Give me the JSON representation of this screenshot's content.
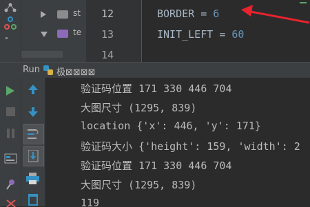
{
  "project_tree": {
    "rows": [
      {
        "label": "st"
      },
      {
        "label": "te"
      }
    ]
  },
  "editor": {
    "lines": [
      {
        "number": "12",
        "name": "BORDER",
        "op": "=",
        "value": "6"
      },
      {
        "number": "13",
        "name": "INIT_LEFT",
        "op": "=",
        "value": "60"
      },
      {
        "number": "14",
        "name": "",
        "op": "",
        "value": ""
      }
    ]
  },
  "run_panel": {
    "tab_label": "Run",
    "config_name": "极⊠⊠⊠⊠",
    "console_lines": [
      "验证码位置 171 330 446 704",
      "大图尺寸 (1295, 839)",
      "location {'x': 446, 'y': 171}",
      "验证码大小 {'height': 159, 'width': 2",
      "验证码位置 171 330 446 704",
      "大图尺寸 (1295, 839)",
      "119"
    ]
  },
  "colors": {
    "annotation_arrow": "#e8232d",
    "accent_green": "#59a869",
    "accent_blue": "#3592c4",
    "folder_purple": "#8d6ab8"
  }
}
